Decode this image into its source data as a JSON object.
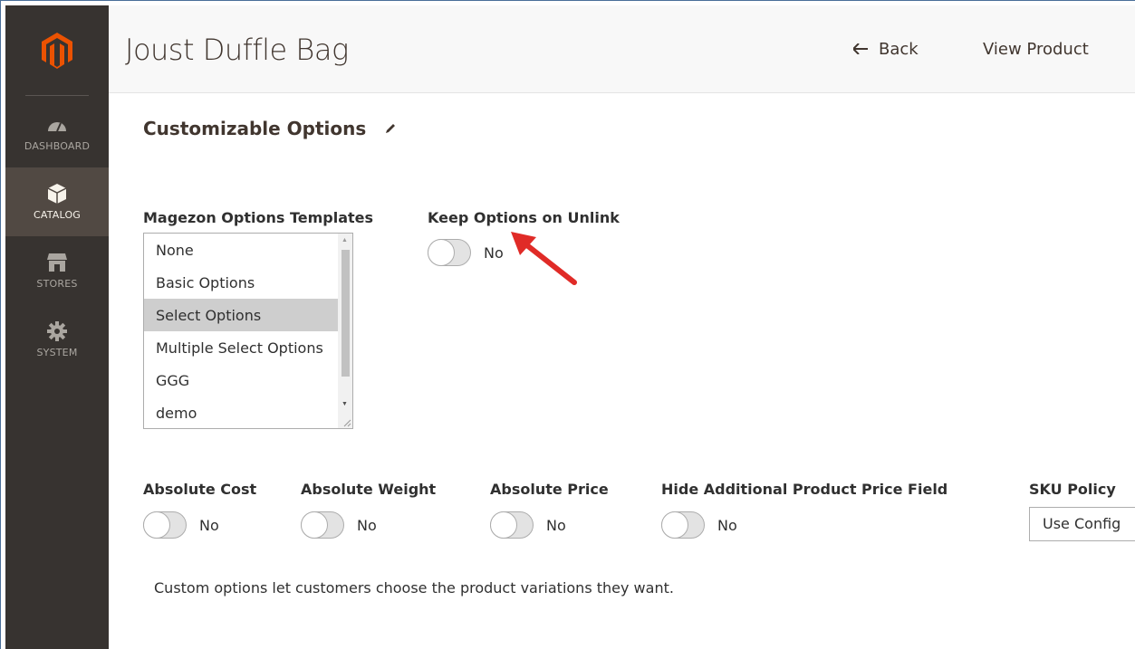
{
  "sidebar": {
    "logo": "magento-logo",
    "items": [
      {
        "label": "DASHBOARD",
        "icon": "dashboard-icon"
      },
      {
        "label": "CATALOG",
        "icon": "catalog-box-icon",
        "active": true
      },
      {
        "label": "STORES",
        "icon": "stores-icon"
      },
      {
        "label": "SYSTEM",
        "icon": "gear-icon"
      }
    ]
  },
  "header": {
    "title": "Joust Duffle Bag",
    "back_label": "Back",
    "view_label": "View Product"
  },
  "section": {
    "title": "Customizable Options",
    "edit_icon": "pencil-icon"
  },
  "templates": {
    "label": "Magezon Options Templates",
    "options": [
      "None",
      "Basic Options",
      "Select Options",
      "Multiple Select Options",
      "GGG",
      "demo"
    ],
    "selected": "Select Options"
  },
  "keep_options": {
    "label": "Keep Options on Unlink",
    "value": "No"
  },
  "toggles": [
    {
      "label": "Absolute Cost",
      "value": "No"
    },
    {
      "label": "Absolute Weight",
      "value": "No"
    },
    {
      "label": "Absolute Price",
      "value": "No"
    },
    {
      "label": "Hide Additional Product Price Field",
      "value": "No"
    }
  ],
  "sku_policy": {
    "label": "SKU Policy",
    "value": "Use Config"
  },
  "note": "Custom options let customers choose the product variations they want.",
  "colors": {
    "sidebar_bg": "#373330",
    "sidebar_active": "#514943",
    "logo_orange": "#eb5202",
    "arrow_red": "#e02b27"
  }
}
